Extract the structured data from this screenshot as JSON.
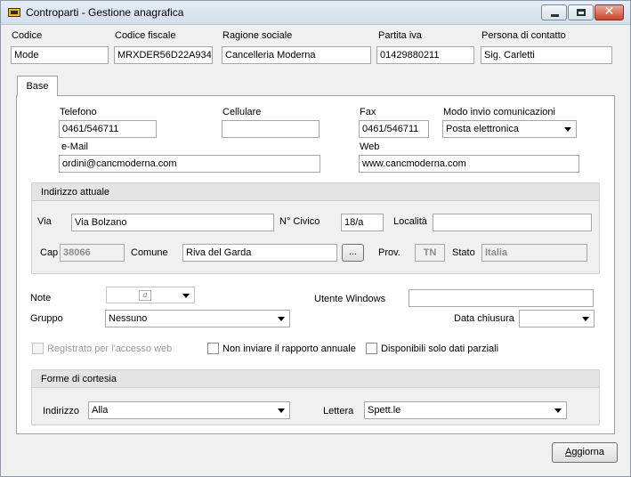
{
  "window": {
    "title": "Controparti - Gestione anagrafica",
    "close_glyph": "✕"
  },
  "header": {
    "codice": {
      "label": "Codice",
      "value": "Mode"
    },
    "codice_fiscale": {
      "label": "Codice fiscale",
      "value": "MRXDER56D22A934D"
    },
    "ragione_sociale": {
      "label": "Ragione sociale",
      "value": "Cancelleria Moderna"
    },
    "partita_iva": {
      "label": "Partita iva",
      "value": "01429880211"
    },
    "persona_contatto": {
      "label": "Persona di contatto",
      "value": "Sig. Carletti"
    }
  },
  "tabs": [
    {
      "label": "Base"
    }
  ],
  "base": {
    "telefono": {
      "label": "Telefono",
      "value": "0461/546711"
    },
    "cellulare": {
      "label": "Cellulare",
      "value": ""
    },
    "fax": {
      "label": "Fax",
      "value": "0461/546711"
    },
    "modo_invio": {
      "label": "Modo invio comunicazioni",
      "value": "Posta elettronica"
    },
    "email": {
      "label": "e-Mail",
      "value": "ordini@cancmoderna.com"
    },
    "web": {
      "label": "Web",
      "value": "www.cancmoderna.com"
    }
  },
  "indirizzo": {
    "title": "Indirizzo attuale",
    "via": {
      "label": "Via",
      "value": "Via Bolzano"
    },
    "civico": {
      "label": "N° Civico",
      "value": "18/a"
    },
    "localita": {
      "label": "Località",
      "value": ""
    },
    "cap": {
      "label": "Cap",
      "value": "38066"
    },
    "comune": {
      "label": "Comune",
      "value": "Riva del Garda"
    },
    "browse_label": "...",
    "prov": {
      "label": "Prov.",
      "value": "TN"
    },
    "stato": {
      "label": "Stato",
      "value": "Italia"
    }
  },
  "altri": {
    "note": {
      "label": "Note",
      "icon_glyph": "a"
    },
    "utente_windows": {
      "label": "Utente Windows",
      "value": ""
    },
    "gruppo": {
      "label": "Gruppo",
      "value": "Nessuno"
    },
    "data_chiusura": {
      "label": "Data chiusura",
      "value": ""
    },
    "registrato_web": {
      "label": "Registrato per l'accesso web",
      "checked": false
    },
    "non_inviare": {
      "label": "Non inviare il rapporto annuale",
      "checked": false
    },
    "dati_parziali": {
      "label": "Disponibili solo dati parziali",
      "checked": false
    }
  },
  "cortesia": {
    "title": "Forme di cortesia",
    "indirizzo": {
      "label": "Indirizzo",
      "value": "Alla"
    },
    "lettera": {
      "label": "Lettera",
      "value": "Spett.le"
    }
  },
  "footer": {
    "aggiorna_first": "A",
    "aggiorna_rest": "ggiorna"
  }
}
